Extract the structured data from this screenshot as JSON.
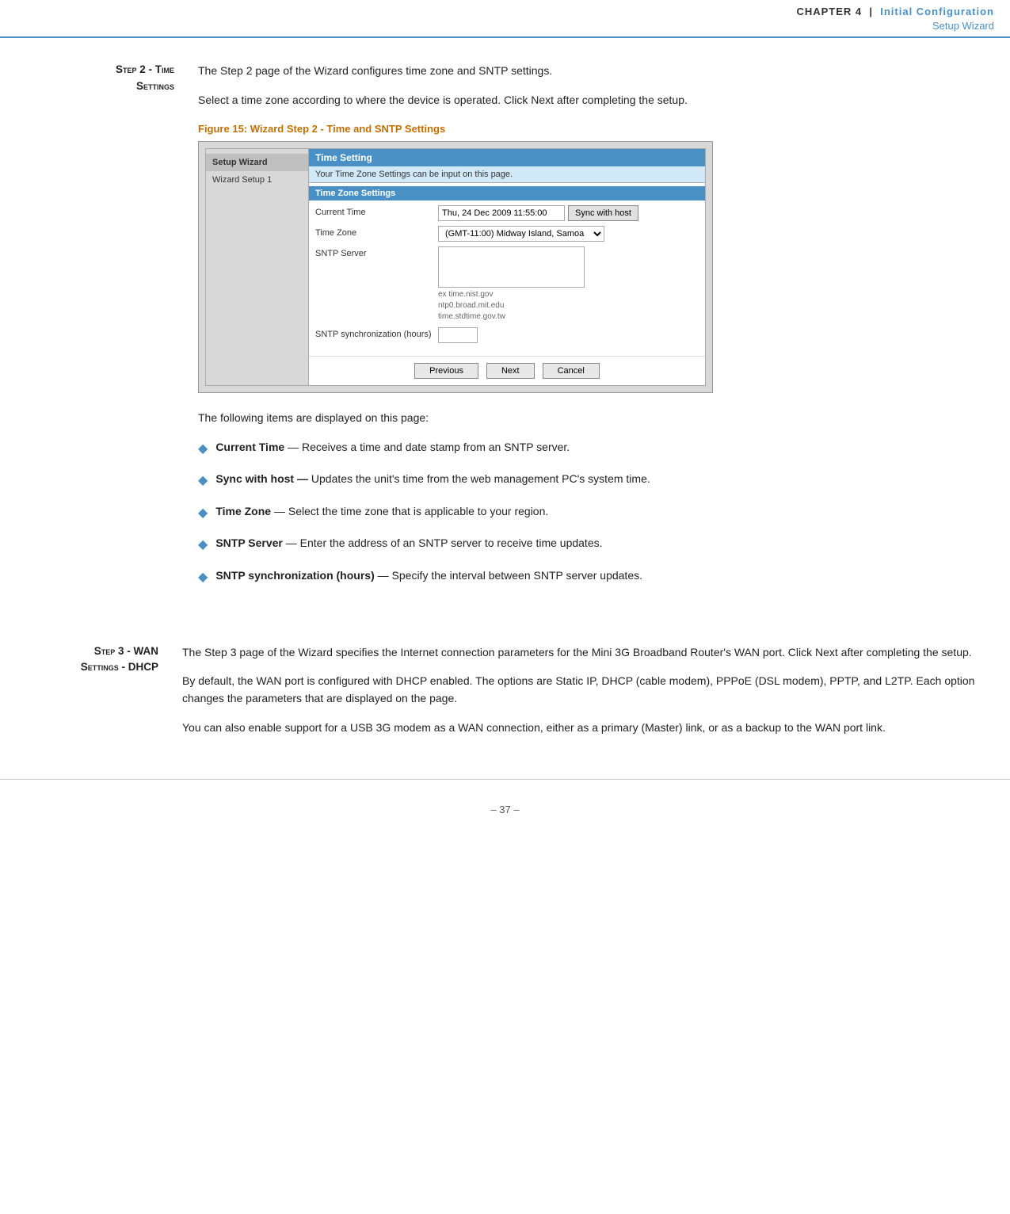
{
  "header": {
    "chapter_label": "CHAPTER 4",
    "chapter_num": "4",
    "section1": "Initial Configuration",
    "section2": "Setup Wizard"
  },
  "step2": {
    "heading_line1": "Step 2 - Time",
    "heading_line2": "Settings",
    "intro_line1": "The Step 2 page of the Wizard configures time zone and SNTP settings.",
    "intro_line2": "Select a time zone according to where the device is operated. Click Next after completing the setup.",
    "figure_caption": "Figure 15:  Wizard Step 2 - Time and SNTP Settings"
  },
  "wizard": {
    "sidebar_item1": "Setup Wizard",
    "sidebar_item2": "Wizard Setup 1",
    "section_title": "Time Setting",
    "section_desc": "Your Time Zone Settings can be input on this page.",
    "zone_header": "Time Zone Settings",
    "current_time_label": "Current Time",
    "current_time_value": "Thu, 24 Dec 2009 11:55:00",
    "sync_btn": "Sync with host",
    "timezone_label": "Time Zone",
    "timezone_value": "(GMT-11:00) Midway Island, Samoa",
    "sntp_label": "SNTP Server",
    "sntp_placeholder_line1": "ex time.nist.gov",
    "sntp_placeholder_line2": "ntp0.broad.mit.edu",
    "sntp_placeholder_line3": "time.stdtime.gov.tw",
    "sntp_hours_label": "SNTP synchronization (hours)",
    "btn_previous": "Previous",
    "btn_next": "Next",
    "btn_cancel": "Cancel"
  },
  "bullets": {
    "intro": "The following items are displayed on this page:",
    "items": [
      {
        "term": "Current Time",
        "dash": "—",
        "desc": " Receives a time and date stamp from an SNTP server."
      },
      {
        "term": "Sync with host —",
        "desc": " Updates the unit's time from the web management PC's system time."
      },
      {
        "term": "Time Zone",
        "dash": "— ",
        "desc": " Select the time zone that is applicable to your region."
      },
      {
        "term": "SNTP Server",
        "dash": "—",
        "desc": " Enter the address of an SNTP server to receive time updates."
      },
      {
        "term": "SNTP synchronization (hours)",
        "dash": "—",
        "desc": " Specify the interval between SNTP server updates."
      }
    ]
  },
  "step3": {
    "heading_line1": "Step 3 - WAN",
    "heading_line2": "Settings - DHCP",
    "para1": "The Step 3 page of the Wizard specifies the Internet connection parameters for the Mini 3G Broadband Router's WAN port. Click Next after completing the setup.",
    "para2": "By default, the WAN port is configured with DHCP enabled. The options are Static IP, DHCP (cable modem), PPPoE (DSL modem), PPTP, and L2TP. Each option changes the parameters that are displayed on the page.",
    "para3": "You can also enable support for a USB 3G modem as a WAN connection, either as a primary (Master) link, or as a backup to the WAN port link."
  },
  "footer": {
    "text": "–  37  –"
  }
}
